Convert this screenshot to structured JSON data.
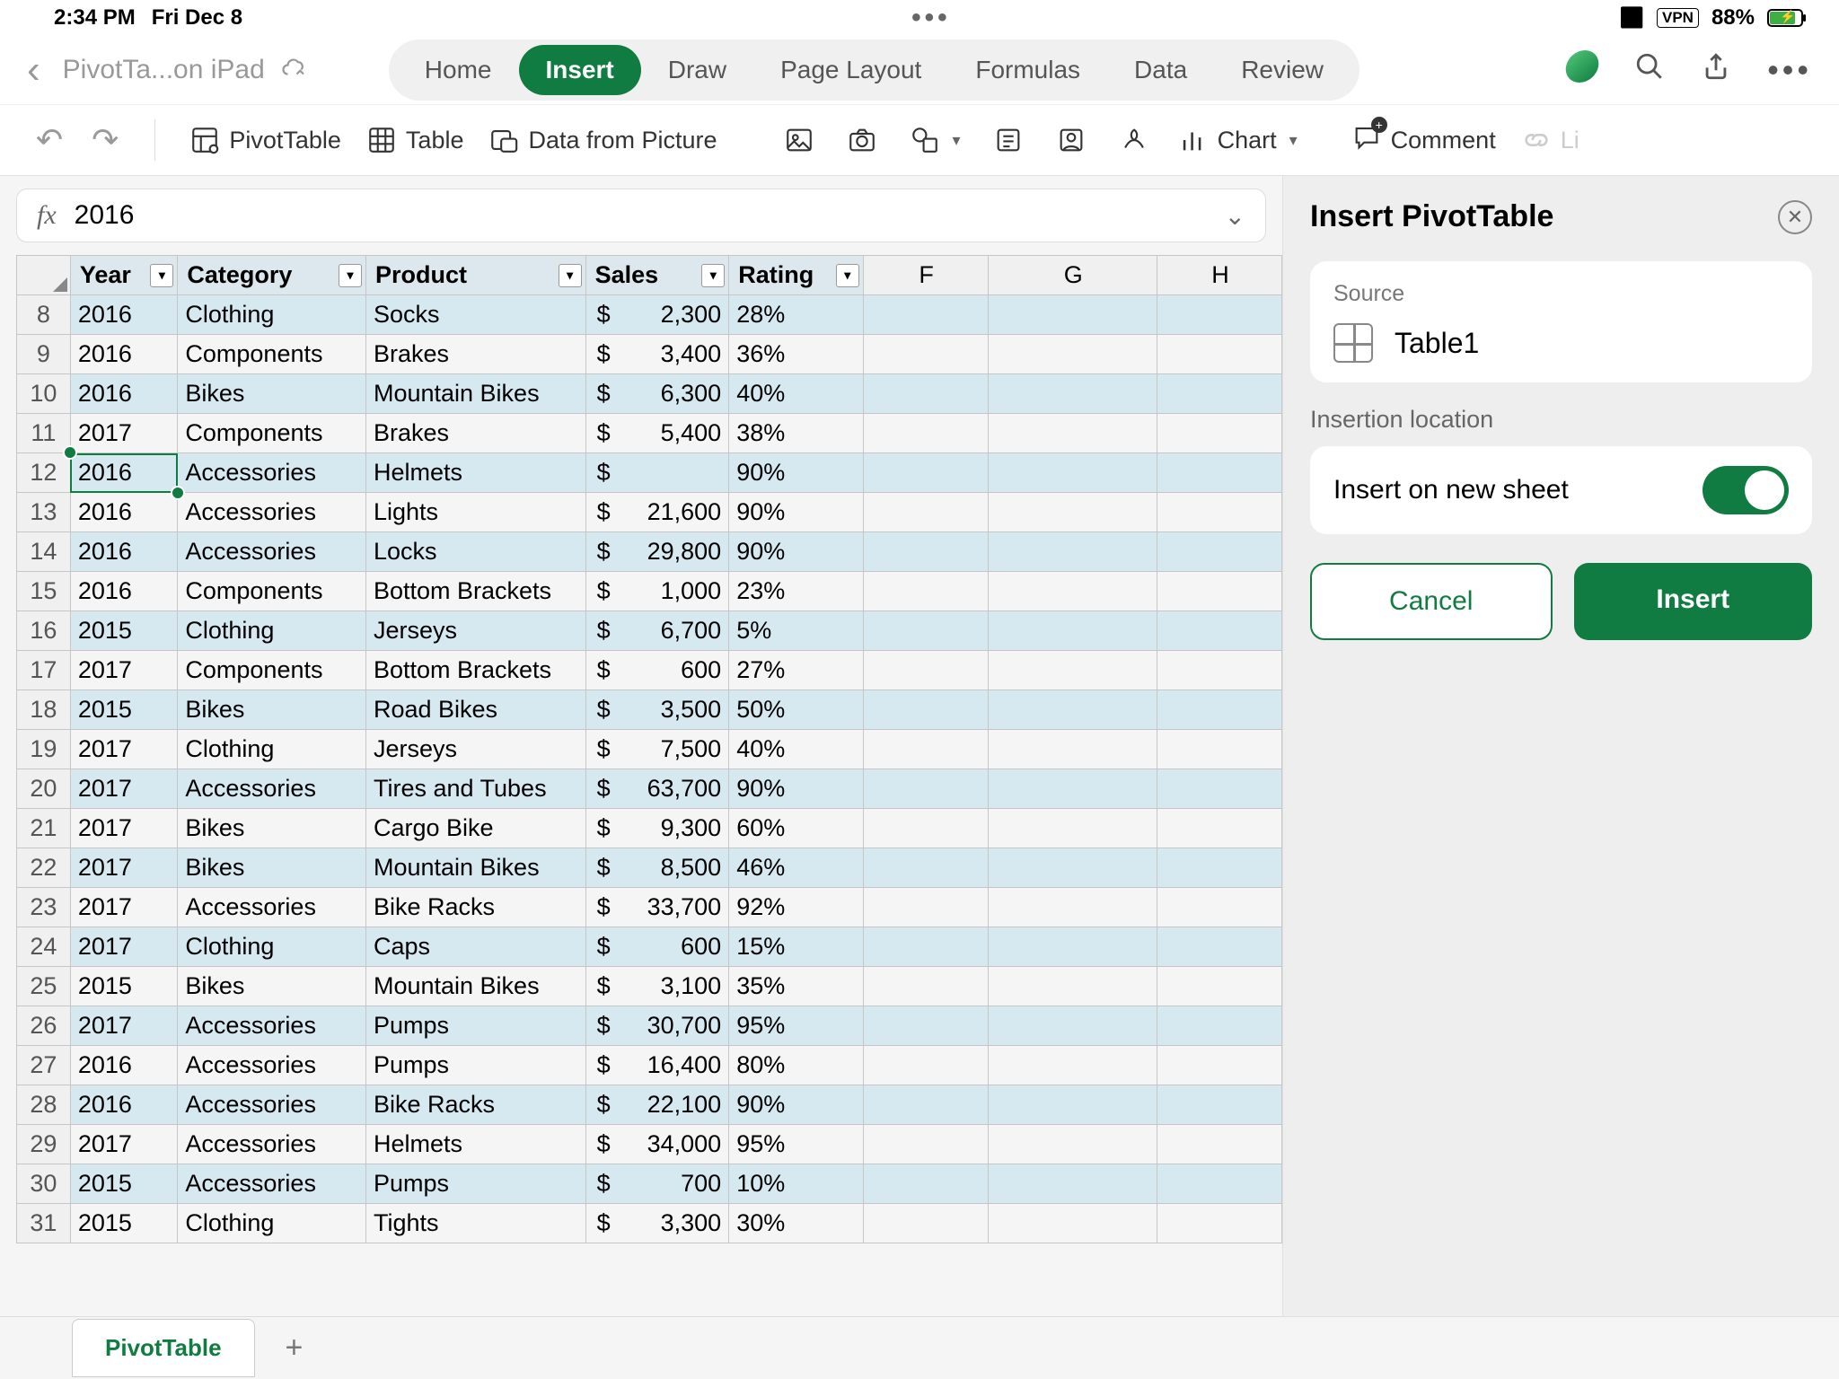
{
  "status": {
    "time": "2:34 PM",
    "date": "Fri Dec 8",
    "battery": "88%"
  },
  "titlebar": {
    "doc": "PivotTa...on iPad",
    "tabs": [
      "Home",
      "Insert",
      "Draw",
      "Page Layout",
      "Formulas",
      "Data",
      "Review"
    ],
    "active_tab_index": 1
  },
  "toolbar": {
    "pivottable": "PivotTable",
    "table": "Table",
    "data_picture": "Data from Picture",
    "chart": "Chart",
    "comment": "Comment",
    "link": "Li"
  },
  "formula": {
    "fx": "fx",
    "value": "2016"
  },
  "headers": {
    "year": "Year",
    "category": "Category",
    "product": "Product",
    "sales": "Sales",
    "rating": "Rating",
    "f": "F",
    "g": "G",
    "h": "H"
  },
  "rows": [
    {
      "num": "8",
      "year": "2016",
      "cat": "Clothing",
      "prod": "Socks",
      "sales": "2,300",
      "rating": "28%"
    },
    {
      "num": "9",
      "year": "2016",
      "cat": "Components",
      "prod": "Brakes",
      "sales": "3,400",
      "rating": "36%"
    },
    {
      "num": "10",
      "year": "2016",
      "cat": "Bikes",
      "prod": "Mountain Bikes",
      "sales": "6,300",
      "rating": "40%"
    },
    {
      "num": "11",
      "year": "2017",
      "cat": "Components",
      "prod": "Brakes",
      "sales": "5,400",
      "rating": "38%"
    },
    {
      "num": "12",
      "year": "2016",
      "cat": "Accessories",
      "prod": "Helmets",
      "sales": "",
      "rating": "90%"
    },
    {
      "num": "13",
      "year": "2016",
      "cat": "Accessories",
      "prod": "Lights",
      "sales": "21,600",
      "rating": "90%"
    },
    {
      "num": "14",
      "year": "2016",
      "cat": "Accessories",
      "prod": "Locks",
      "sales": "29,800",
      "rating": "90%"
    },
    {
      "num": "15",
      "year": "2016",
      "cat": "Components",
      "prod": "Bottom Brackets",
      "sales": "1,000",
      "rating": "23%"
    },
    {
      "num": "16",
      "year": "2015",
      "cat": "Clothing",
      "prod": "Jerseys",
      "sales": "6,700",
      "rating": "5%"
    },
    {
      "num": "17",
      "year": "2017",
      "cat": "Components",
      "prod": "Bottom Brackets",
      "sales": "600",
      "rating": "27%"
    },
    {
      "num": "18",
      "year": "2015",
      "cat": "Bikes",
      "prod": "Road Bikes",
      "sales": "3,500",
      "rating": "50%"
    },
    {
      "num": "19",
      "year": "2017",
      "cat": "Clothing",
      "prod": "Jerseys",
      "sales": "7,500",
      "rating": "40%"
    },
    {
      "num": "20",
      "year": "2017",
      "cat": "Accessories",
      "prod": "Tires and Tubes",
      "sales": "63,700",
      "rating": "90%"
    },
    {
      "num": "21",
      "year": "2017",
      "cat": "Bikes",
      "prod": "Cargo Bike",
      "sales": "9,300",
      "rating": "60%"
    },
    {
      "num": "22",
      "year": "2017",
      "cat": "Bikes",
      "prod": "Mountain Bikes",
      "sales": "8,500",
      "rating": "46%"
    },
    {
      "num": "23",
      "year": "2017",
      "cat": "Accessories",
      "prod": "Bike Racks",
      "sales": "33,700",
      "rating": "92%"
    },
    {
      "num": "24",
      "year": "2017",
      "cat": "Clothing",
      "prod": "Caps",
      "sales": "600",
      "rating": "15%"
    },
    {
      "num": "25",
      "year": "2015",
      "cat": "Bikes",
      "prod": "Mountain Bikes",
      "sales": "3,100",
      "rating": "35%"
    },
    {
      "num": "26",
      "year": "2017",
      "cat": "Accessories",
      "prod": "Pumps",
      "sales": "30,700",
      "rating": "95%"
    },
    {
      "num": "27",
      "year": "2016",
      "cat": "Accessories",
      "prod": "Pumps",
      "sales": "16,400",
      "rating": "80%"
    },
    {
      "num": "28",
      "year": "2016",
      "cat": "Accessories",
      "prod": "Bike Racks",
      "sales": "22,100",
      "rating": "90%"
    },
    {
      "num": "29",
      "year": "2017",
      "cat": "Accessories",
      "prod": "Helmets",
      "sales": "34,000",
      "rating": "95%"
    },
    {
      "num": "30",
      "year": "2015",
      "cat": "Accessories",
      "prod": "Pumps",
      "sales": "700",
      "rating": "10%"
    },
    {
      "num": "31",
      "year": "2015",
      "cat": "Clothing",
      "prod": "Tights",
      "sales": "3,300",
      "rating": "30%"
    }
  ],
  "selected_row": "12",
  "panel": {
    "title": "Insert PivotTable",
    "source_label": "Source",
    "source_name": "Table1",
    "location_label": "Insertion location",
    "insert_new": "Insert on new sheet",
    "cancel": "Cancel",
    "insert": "Insert"
  },
  "sheet_tab": "PivotTable"
}
